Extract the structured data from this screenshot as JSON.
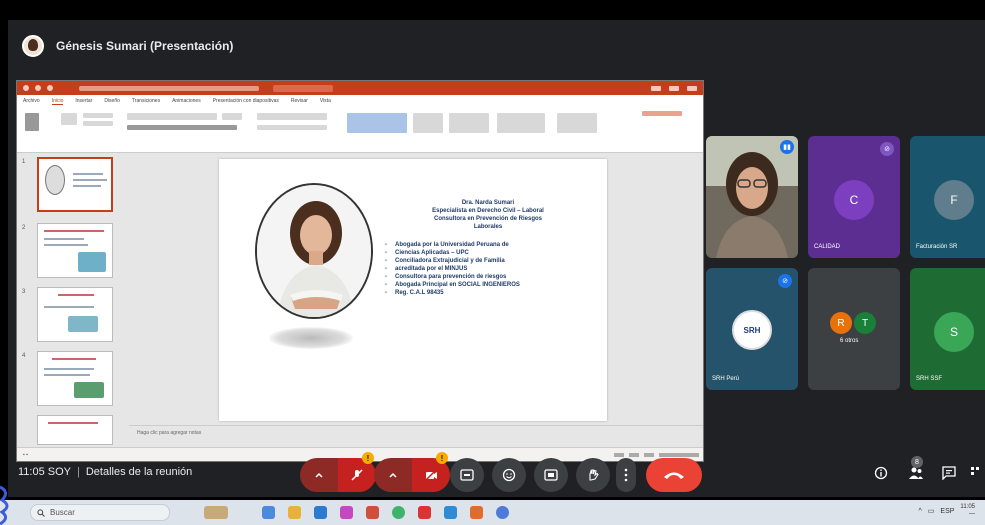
{
  "presenter": {
    "name": "Génesis Sumari (Presentación)"
  },
  "slide": {
    "heading_lines": [
      "Dra. Narda Sumari",
      "Especialista en Derecho Civil – Laboral",
      "Consultora en Prevención de Riesgos",
      "Laborales"
    ],
    "bullets": [
      "Abogada por la Universidad Peruana de",
      "Ciencias Aplicadas – UPC",
      "Conciliadora Extrajudicial y de Familia",
      "acreditada por el MINJUS",
      "Consultora para prevención de riesgos",
      "Abogada Principal en SOCIAL INGENIEROS",
      "Reg. C.A.L 98435"
    ]
  },
  "ppt": {
    "notes_placeholder": "Haga clic para agregar notas",
    "menu": [
      "Archivo",
      "Inicio",
      "Insertar",
      "Diseño",
      "Transiciones",
      "Animaciones",
      "Presentación con diapositivas",
      "Revisar",
      "Vista"
    ]
  },
  "participants": [
    {
      "label": "",
      "kind": "video"
    },
    {
      "label": "CALIDAD",
      "initial": "C",
      "color": "#7b3fbf",
      "bg": "#5c2e91"
    },
    {
      "label": "Facturación SR",
      "initial": "F",
      "color": "#5f7d8c",
      "bg": "#19566e"
    },
    {
      "label": "SRH Perú",
      "kind": "logo",
      "bg": "#24536b"
    },
    {
      "label": "6 otros",
      "initials": [
        "R",
        "T"
      ],
      "bg": "#3c4043"
    },
    {
      "label": "SRH SSF",
      "initial": "S",
      "color": "#3aa757",
      "bg": "#1e6b34"
    }
  ],
  "bottom_bar": {
    "time": "11:05 SOY",
    "details": "Detalles de la reunión",
    "people_count": "8"
  },
  "taskbar": {
    "search_placeholder": "Buscar",
    "lang": "ESP",
    "clock_time": "11:05",
    "clock_date": "—"
  },
  "colors": {
    "meet_bg": "#202124",
    "ppt_accent": "#c43e1c",
    "hangup": "#ea4335",
    "warning": "#f9ab00"
  }
}
